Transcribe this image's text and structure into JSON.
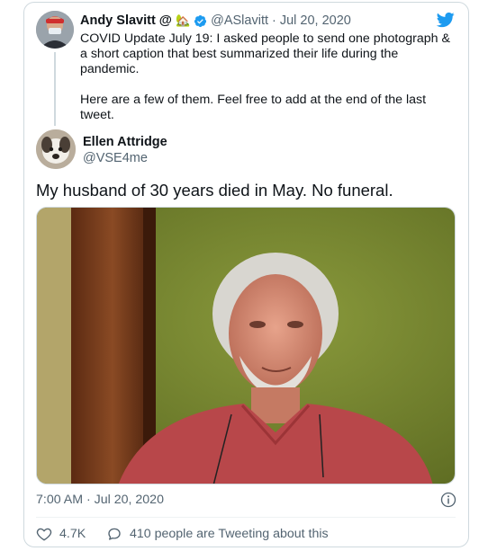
{
  "parent_tweet": {
    "author_name": "Andy Slavitt",
    "name_suffix": "@",
    "house_emoji": "🏡",
    "handle": "@ASlavitt",
    "separator": "·",
    "date": "Jul 20, 2020",
    "paragraphs": [
      "COVID Update July 19: I asked people to send one photograph & a short caption that best summarized their life during the pandemic.",
      "Here are a few of them. Feel free to add at the end of the last tweet."
    ]
  },
  "main_tweet": {
    "author_name": "Ellen Attridge",
    "handle": "@VSE4me",
    "text": "My husband of 30 years died in May.  No funeral.",
    "timestamp": "7:00 AM · Jul 20, 2020",
    "likes": "4.7K",
    "tweeting_text": "410 people are Tweeting about this"
  },
  "icons": {
    "verified": "verified-badge-icon",
    "logo": "twitter-bird-icon",
    "info": "info-icon",
    "like": "heart-icon",
    "reply": "speech-bubble-icon"
  },
  "colors": {
    "twitter_blue": "#1d9bf0",
    "secondary_text": "#536471",
    "border": "#cfd9de"
  }
}
